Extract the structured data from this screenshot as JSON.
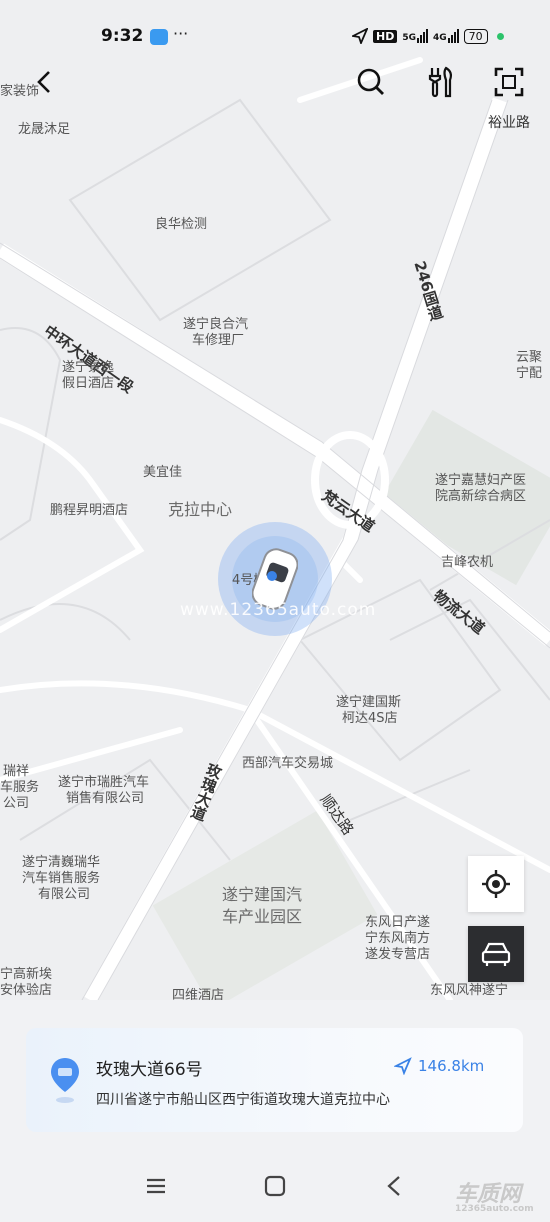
{
  "status": {
    "time": "9:32",
    "icons": [
      "cloud-icon",
      "location-arrow-icon",
      "hd-icon",
      "signal-5g-icon",
      "signal-4g-icon"
    ],
    "hd_label": "HD",
    "net1": "5G",
    "net2": "4G",
    "battery": "70"
  },
  "toolbar": {
    "back_icon": "chevron-left-icon",
    "search_icon": "search-icon",
    "settings_icon": "tools-icon",
    "scan_icon": "scan-icon"
  },
  "map": {
    "roads": {
      "zhonghuan": "中环大道西一段",
      "guodao": "246国道",
      "fanyun": "梵云大道",
      "wuliu": "物流大道",
      "meigui": "玫瑰大道",
      "shunda": "顺达路",
      "yuye": "裕业路"
    },
    "pois": {
      "jiazhuang": "家装饰",
      "longsheng": "龙晟沐足",
      "lianghua": "良华检测",
      "liangge1": "遂宁良合汽",
      "liangge2": "车修理厂",
      "yunju1": "云聚",
      "yunju2": "宁配",
      "jingyi1": "遂宁景逸",
      "jingyi2": "假日酒店",
      "meiyijia": "美宜佳",
      "jiahui1": "遂宁嘉慧妇产医",
      "jiahui2": "院高新综合病区",
      "pengcheng": "鹏程昇明酒店",
      "kela": "克拉中心",
      "jifeng": "吉峰农机",
      "building4": "4号楼",
      "jianguosi1": "遂宁建国斯",
      "jianguosi2": "柯达4S店",
      "xibu": "西部汽车交易城",
      "ruixiang1": "瑞祥",
      "ruixiang2": "车服务",
      "ruixiang3": "公司",
      "ruisheng1": "遂宁市瑞胜汽车",
      "ruisheng2": "销售有限公司",
      "qingwei1": "遂宁清巍瑞华",
      "qingwei2": "汽车销售服务",
      "qingwei3": "有限公司",
      "jianguo1": "遂宁建国汽",
      "jianguo2": "车产业园区",
      "dongfeng1": "东风日产遂",
      "dongfeng2": "宁东风南方",
      "dongfeng3": "遂发专营店",
      "gaoxin1": "宁高新埃",
      "gaoxin2": "安体验店",
      "siwei": "四维酒店",
      "dfshenjian": "东风风神遂宁"
    },
    "watermark": "www.12365auto.com"
  },
  "controls": {
    "locate_icon": "crosshair-icon",
    "car_icon": "car-icon"
  },
  "card": {
    "pin_icon": "location-pin-icon",
    "title": "玫瑰大道66号",
    "distance": "146.8km",
    "nav_icon": "navigate-arrow-icon",
    "address": "四川省遂宁市船山区西宁街道玫瑰大道克拉中心"
  },
  "navbar": {
    "menu_icon": "menu-icon",
    "home_icon": "square-home-icon",
    "back_icon": "triangle-back-icon"
  },
  "logo": {
    "text": "车质网",
    "url_text": "12365auto.com"
  },
  "colors": {
    "accent": "#3a82e6",
    "map_bg": "#eeeff1",
    "road": "#ffffff",
    "dark_button": "#2c2d30",
    "online": "#2cc36b"
  }
}
